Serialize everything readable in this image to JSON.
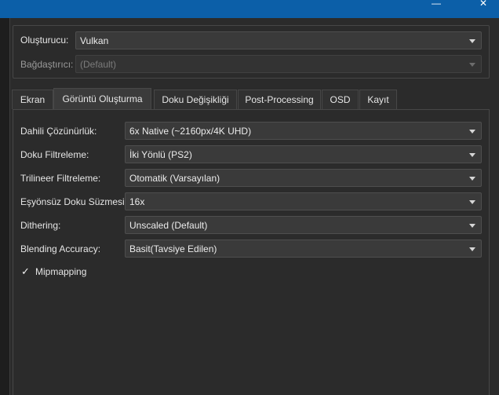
{
  "window": {
    "controls": [
      "—",
      "✕"
    ]
  },
  "renderer": {
    "label": "Oluşturucu:",
    "value": "Vulkan"
  },
  "adapter": {
    "label": "Bağdaştırıcı:",
    "value": "(Default)"
  },
  "tabs": [
    "Ekran",
    "Görüntü Oluşturma",
    "Doku Değişikliği",
    "Post-Processing",
    "OSD",
    "Kayıt"
  ],
  "settings": [
    {
      "label": "Dahili Çözünürlük:",
      "value": "6x Native (~2160px/4K UHD)"
    },
    {
      "label": "Doku Filtreleme:",
      "value": "İki Yönlü (PS2)"
    },
    {
      "label": "Trilineer Filtreleme:",
      "value": "Otomatik (Varsayılan)"
    },
    {
      "label": "Eşyönsüz Doku Süzmesi:",
      "value": "16x"
    },
    {
      "label": "Dithering:",
      "value": "Unscaled (Default)"
    },
    {
      "label": "Blending Accuracy:",
      "value": "Basit(Tavsiye Edilen)"
    }
  ],
  "mipmapping": {
    "label": "Mipmapping",
    "checked": true,
    "mark": "✓"
  }
}
